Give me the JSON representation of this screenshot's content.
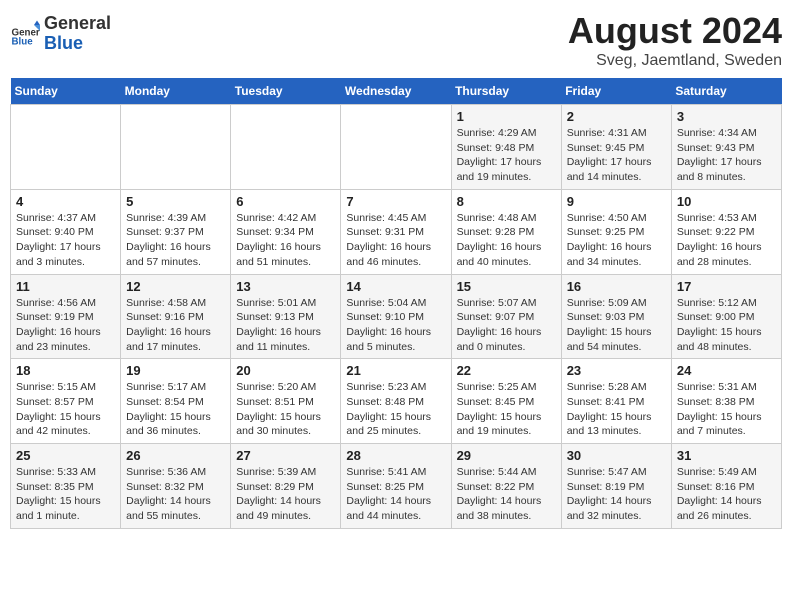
{
  "header": {
    "logo_general": "General",
    "logo_blue": "Blue",
    "month_title": "August 2024",
    "location": "Sveg, Jaemtland, Sweden"
  },
  "weekdays": [
    "Sunday",
    "Monday",
    "Tuesday",
    "Wednesday",
    "Thursday",
    "Friday",
    "Saturday"
  ],
  "weeks": [
    [
      {
        "day": "",
        "info": ""
      },
      {
        "day": "",
        "info": ""
      },
      {
        "day": "",
        "info": ""
      },
      {
        "day": "",
        "info": ""
      },
      {
        "day": "1",
        "info": "Sunrise: 4:29 AM\nSunset: 9:48 PM\nDaylight: 17 hours\nand 19 minutes."
      },
      {
        "day": "2",
        "info": "Sunrise: 4:31 AM\nSunset: 9:45 PM\nDaylight: 17 hours\nand 14 minutes."
      },
      {
        "day": "3",
        "info": "Sunrise: 4:34 AM\nSunset: 9:43 PM\nDaylight: 17 hours\nand 8 minutes."
      }
    ],
    [
      {
        "day": "4",
        "info": "Sunrise: 4:37 AM\nSunset: 9:40 PM\nDaylight: 17 hours\nand 3 minutes."
      },
      {
        "day": "5",
        "info": "Sunrise: 4:39 AM\nSunset: 9:37 PM\nDaylight: 16 hours\nand 57 minutes."
      },
      {
        "day": "6",
        "info": "Sunrise: 4:42 AM\nSunset: 9:34 PM\nDaylight: 16 hours\nand 51 minutes."
      },
      {
        "day": "7",
        "info": "Sunrise: 4:45 AM\nSunset: 9:31 PM\nDaylight: 16 hours\nand 46 minutes."
      },
      {
        "day": "8",
        "info": "Sunrise: 4:48 AM\nSunset: 9:28 PM\nDaylight: 16 hours\nand 40 minutes."
      },
      {
        "day": "9",
        "info": "Sunrise: 4:50 AM\nSunset: 9:25 PM\nDaylight: 16 hours\nand 34 minutes."
      },
      {
        "day": "10",
        "info": "Sunrise: 4:53 AM\nSunset: 9:22 PM\nDaylight: 16 hours\nand 28 minutes."
      }
    ],
    [
      {
        "day": "11",
        "info": "Sunrise: 4:56 AM\nSunset: 9:19 PM\nDaylight: 16 hours\nand 23 minutes."
      },
      {
        "day": "12",
        "info": "Sunrise: 4:58 AM\nSunset: 9:16 PM\nDaylight: 16 hours\nand 17 minutes."
      },
      {
        "day": "13",
        "info": "Sunrise: 5:01 AM\nSunset: 9:13 PM\nDaylight: 16 hours\nand 11 minutes."
      },
      {
        "day": "14",
        "info": "Sunrise: 5:04 AM\nSunset: 9:10 PM\nDaylight: 16 hours\nand 5 minutes."
      },
      {
        "day": "15",
        "info": "Sunrise: 5:07 AM\nSunset: 9:07 PM\nDaylight: 16 hours\nand 0 minutes."
      },
      {
        "day": "16",
        "info": "Sunrise: 5:09 AM\nSunset: 9:03 PM\nDaylight: 15 hours\nand 54 minutes."
      },
      {
        "day": "17",
        "info": "Sunrise: 5:12 AM\nSunset: 9:00 PM\nDaylight: 15 hours\nand 48 minutes."
      }
    ],
    [
      {
        "day": "18",
        "info": "Sunrise: 5:15 AM\nSunset: 8:57 PM\nDaylight: 15 hours\nand 42 minutes."
      },
      {
        "day": "19",
        "info": "Sunrise: 5:17 AM\nSunset: 8:54 PM\nDaylight: 15 hours\nand 36 minutes."
      },
      {
        "day": "20",
        "info": "Sunrise: 5:20 AM\nSunset: 8:51 PM\nDaylight: 15 hours\nand 30 minutes."
      },
      {
        "day": "21",
        "info": "Sunrise: 5:23 AM\nSunset: 8:48 PM\nDaylight: 15 hours\nand 25 minutes."
      },
      {
        "day": "22",
        "info": "Sunrise: 5:25 AM\nSunset: 8:45 PM\nDaylight: 15 hours\nand 19 minutes."
      },
      {
        "day": "23",
        "info": "Sunrise: 5:28 AM\nSunset: 8:41 PM\nDaylight: 15 hours\nand 13 minutes."
      },
      {
        "day": "24",
        "info": "Sunrise: 5:31 AM\nSunset: 8:38 PM\nDaylight: 15 hours\nand 7 minutes."
      }
    ],
    [
      {
        "day": "25",
        "info": "Sunrise: 5:33 AM\nSunset: 8:35 PM\nDaylight: 15 hours\nand 1 minute."
      },
      {
        "day": "26",
        "info": "Sunrise: 5:36 AM\nSunset: 8:32 PM\nDaylight: 14 hours\nand 55 minutes."
      },
      {
        "day": "27",
        "info": "Sunrise: 5:39 AM\nSunset: 8:29 PM\nDaylight: 14 hours\nand 49 minutes."
      },
      {
        "day": "28",
        "info": "Sunrise: 5:41 AM\nSunset: 8:25 PM\nDaylight: 14 hours\nand 44 minutes."
      },
      {
        "day": "29",
        "info": "Sunrise: 5:44 AM\nSunset: 8:22 PM\nDaylight: 14 hours\nand 38 minutes."
      },
      {
        "day": "30",
        "info": "Sunrise: 5:47 AM\nSunset: 8:19 PM\nDaylight: 14 hours\nand 32 minutes."
      },
      {
        "day": "31",
        "info": "Sunrise: 5:49 AM\nSunset: 8:16 PM\nDaylight: 14 hours\nand 26 minutes."
      }
    ]
  ]
}
